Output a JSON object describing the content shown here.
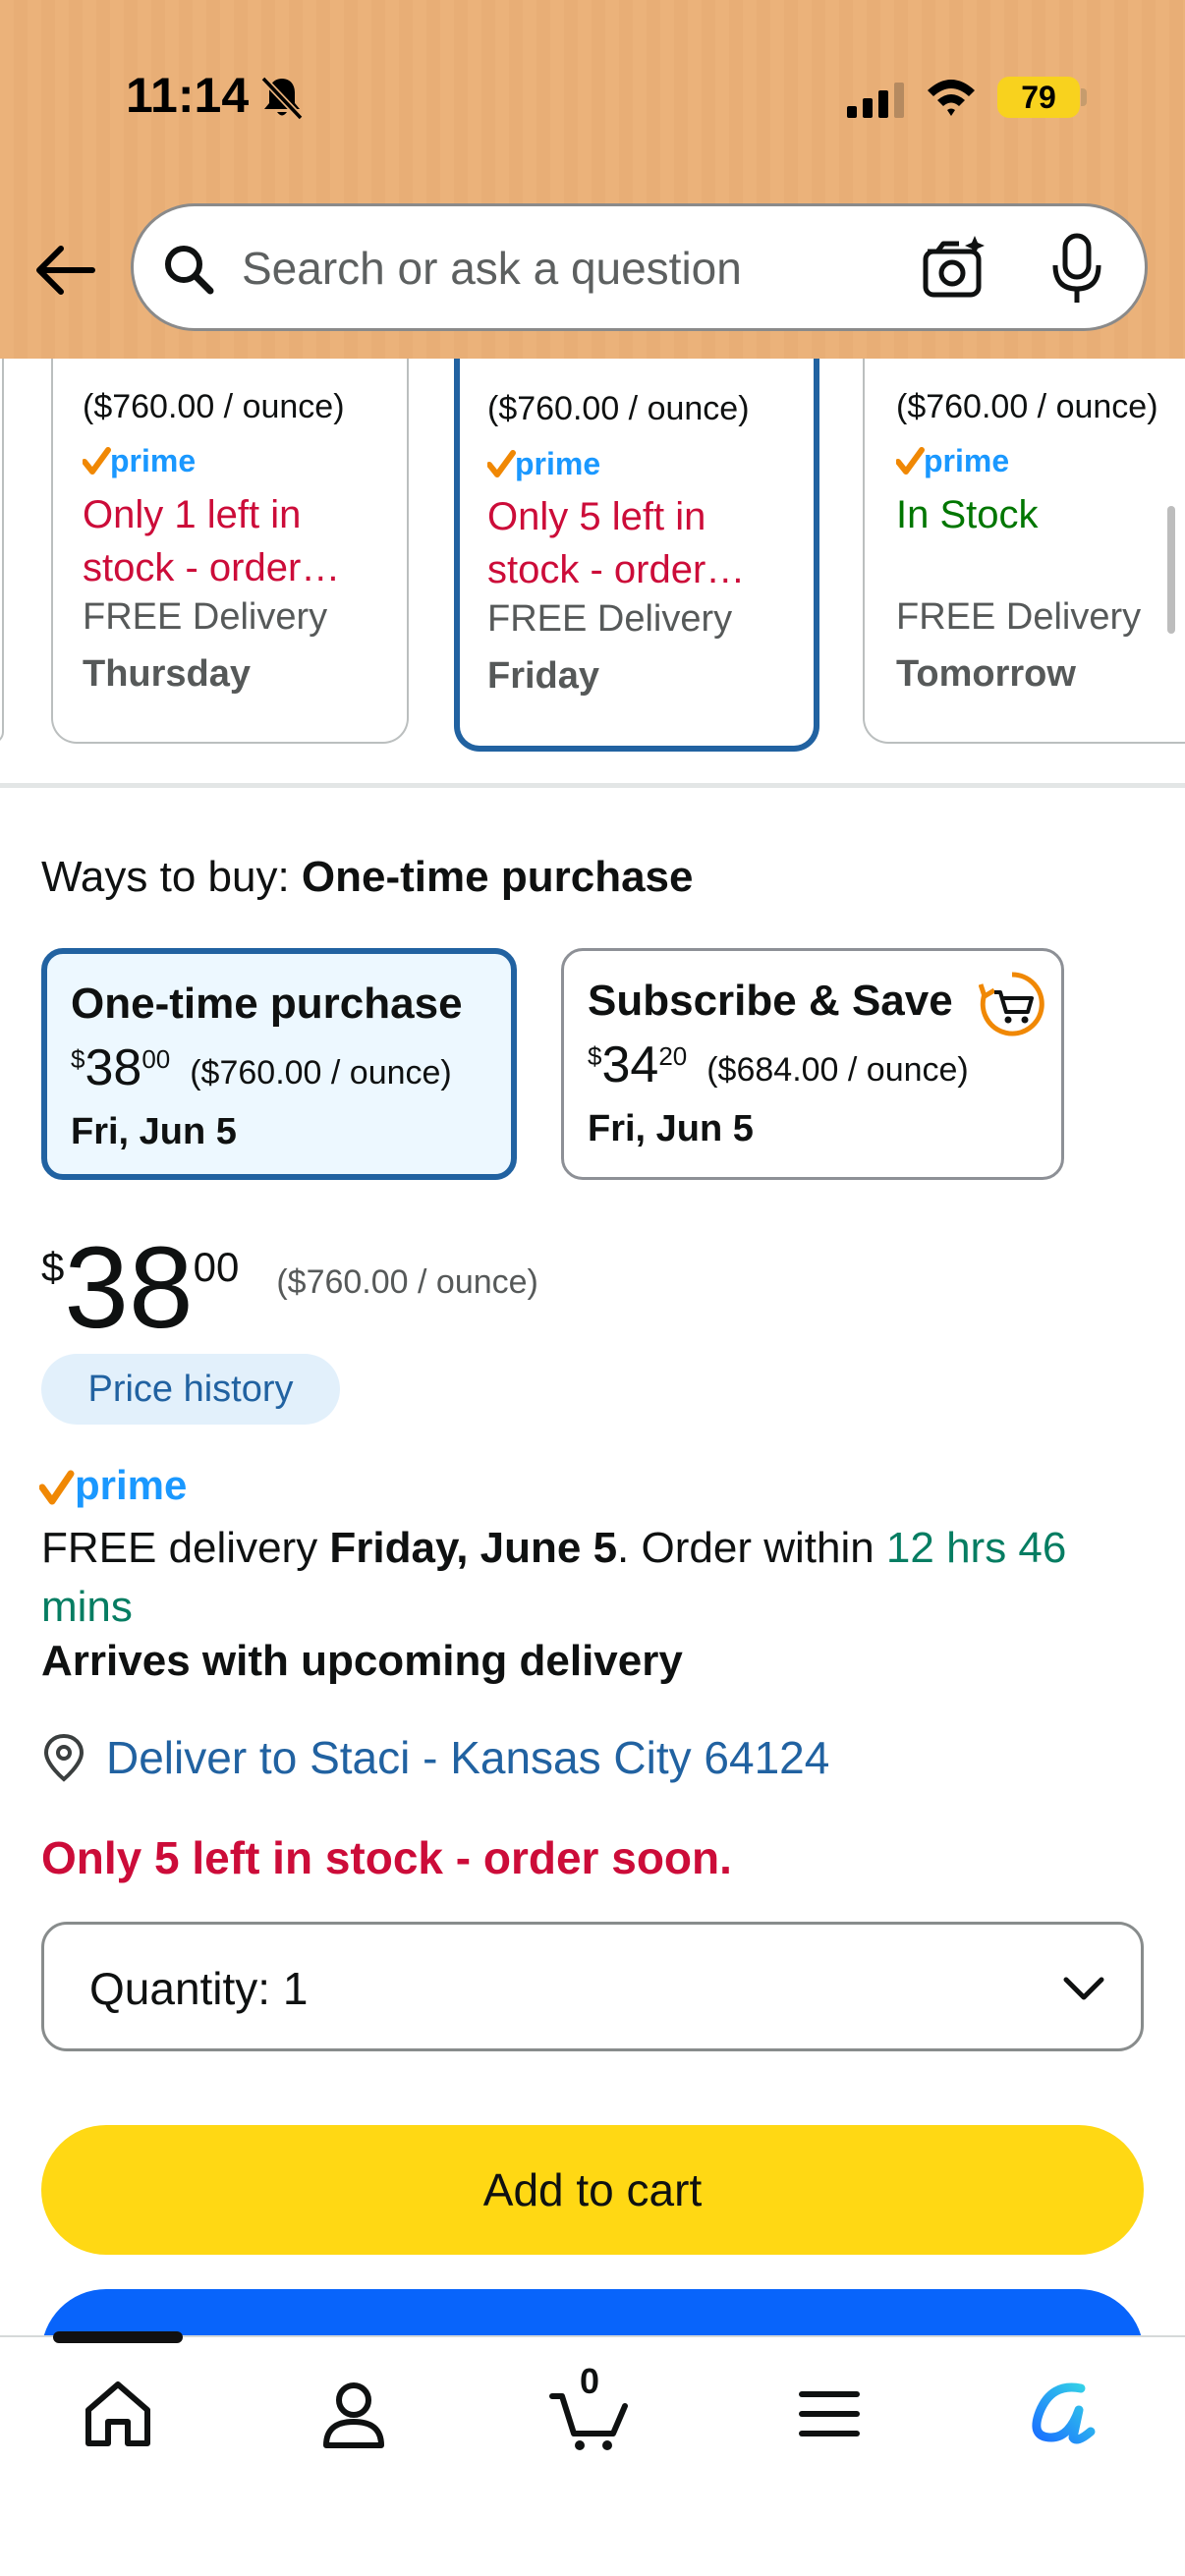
{
  "status_bar": {
    "time": "11:14",
    "battery": "79"
  },
  "search": {
    "placeholder": "Search or ask a question"
  },
  "offers": [
    {
      "unit_price": "($760.00 / ounce)",
      "stock": "Only 1 left in stock - order…",
      "delivery_label": "FREE Delivery",
      "delivery_day": "Thursday"
    },
    {
      "unit_price": "($760.00 / ounce)",
      "stock": "Only 5 left in stock - order…",
      "delivery_label": "FREE Delivery",
      "delivery_day": "Friday"
    },
    {
      "unit_price": "($760.00 / ounce)",
      "stock": "In Stock",
      "delivery_label": "FREE Delivery",
      "delivery_day": "Tomorrow"
    }
  ],
  "ways_to_buy": {
    "label": "Ways to buy:",
    "selected": "One-time purchase",
    "options": [
      {
        "title": "One-time purchase",
        "currency": "$",
        "whole": "38",
        "fraction": "00",
        "unit_price": "($760.00 / ounce)",
        "date": "Fri, Jun 5"
      },
      {
        "title": "Subscribe & Save",
        "currency": "$",
        "whole": "34",
        "fraction": "20",
        "unit_price": "($684.00 / ounce)",
        "date": "Fri, Jun 5"
      }
    ]
  },
  "price": {
    "currency": "$",
    "whole": "38",
    "fraction": "00",
    "unit_price": "($760.00 / ounce)",
    "history_label": "Price history"
  },
  "delivery": {
    "prefix": "FREE delivery ",
    "date": "Friday, June 5",
    "middle": ". Order within ",
    "countdown": "12 hrs 46 mins",
    "arrives": "Arrives with upcoming delivery",
    "deliver_to": "Deliver to Staci - Kansas City 64124"
  },
  "stock_message": "Only 5 left in stock - order soon.",
  "quantity": {
    "label": "Quantity:",
    "value": "1"
  },
  "buttons": {
    "add_to_cart": "Add to cart"
  },
  "bottom_nav": {
    "cart_count": "0"
  },
  "colors": {
    "header": "#ebb27a",
    "selected_border": "#2162a1",
    "add_to_cart": "#ffd814",
    "buy_now": "#0864fb",
    "alert_red": "#cc0c39",
    "stock_green": "#007600"
  }
}
